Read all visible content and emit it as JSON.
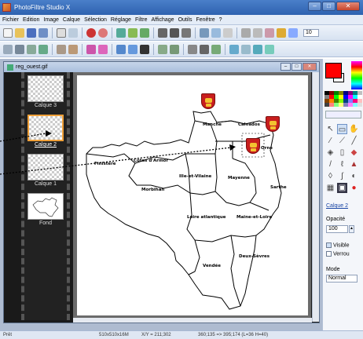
{
  "app": {
    "title": "PhotoFiltre Studio X"
  },
  "menu": [
    "Fichier",
    "Edition",
    "Image",
    "Calque",
    "Sélection",
    "Réglage",
    "Filtre",
    "Affichage",
    "Outils",
    "Fenêtre",
    "?"
  ],
  "document": {
    "title": "reg_ouest.gif"
  },
  "layers": [
    {
      "label": "Calque 3",
      "selected": false
    },
    {
      "label": "Calque 2",
      "selected": true
    },
    {
      "label": "Calque 1",
      "selected": false
    },
    {
      "label": "Fond",
      "selected": false
    }
  ],
  "map": {
    "departments": [
      "Manche",
      "Calvados",
      "Orne",
      "Finistère",
      "Côtes d'Armor",
      "Morbihan",
      "Ille-et-Vilaine",
      "Mayenne",
      "Sarthe",
      "Loire atlantique",
      "Maine-et-Loire",
      "Deux-Sèvres",
      "Vendée"
    ]
  },
  "right_panel": {
    "active_layer_link": "Calque 2",
    "opacity_label": "Opacité",
    "opacity_value": "100",
    "visible_label": "Visible",
    "visible_checked": true,
    "lock_label": "Verrou",
    "lock_checked": false,
    "mode_label": "Mode",
    "mode_value": "Normal",
    "foreground_color": "#ff0000",
    "background_color": "#ffffff"
  },
  "status": {
    "state": "Prêt",
    "size": "510x510x16M",
    "xy": "X/Y = 211;302",
    "selection": "360;135 => 395;174 (L=36 H=40)"
  },
  "zoom": "10"
}
